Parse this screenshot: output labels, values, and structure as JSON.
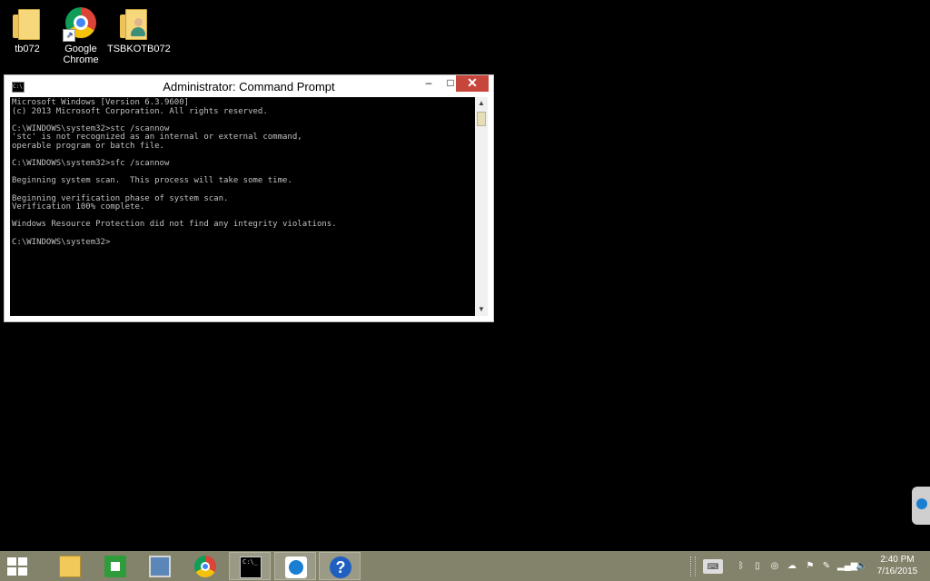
{
  "desktop": {
    "icons": [
      {
        "label": "tb072"
      },
      {
        "label_line1": "Google",
        "label_line2": "Chrome"
      },
      {
        "label": "TSBKOTB072"
      }
    ]
  },
  "window": {
    "title": "Administrator: Command Prompt",
    "icon_text": "C:\\",
    "minimize": "–",
    "maximize": "□",
    "close": "✕",
    "console_lines": [
      "Microsoft Windows [Version 6.3.9600]",
      "(c) 2013 Microsoft Corporation. All rights reserved.",
      "",
      "C:\\WINDOWS\\system32>stc /scannow",
      "'stc' is not recognized as an internal or external command,",
      "operable program or batch file.",
      "",
      "C:\\WINDOWS\\system32>sfc /scannow",
      "",
      "Beginning system scan.  This process will take some time.",
      "",
      "Beginning verification phase of system scan.",
      "Verification 100% complete.",
      "",
      "Windows Resource Protection did not find any integrity violations.",
      "",
      "C:\\WINDOWS\\system32>"
    ],
    "scroll_up": "▲",
    "scroll_down": "▼"
  },
  "taskbar": {
    "cmd_glyph_text": "C:\\_",
    "help_glyph_text": "?",
    "keyboard_icon_text": "⌨",
    "tray_icons": [
      "bluetooth-icon",
      "phone-icon",
      "network-icon",
      "cloud-icon",
      "flag-icon",
      "tools-icon",
      "signal-icon",
      "volume-icon"
    ],
    "tray_glyphs": [
      "ᛒ",
      "▯",
      "◎",
      "☁",
      "⚑",
      "✎",
      "▂▄▆",
      "🔈"
    ],
    "time": "2:40 PM",
    "date": "7/16/2015"
  },
  "colors": {
    "taskbar": "#83826a",
    "close_button": "#c7463b",
    "console_text": "#c0c0c0"
  }
}
